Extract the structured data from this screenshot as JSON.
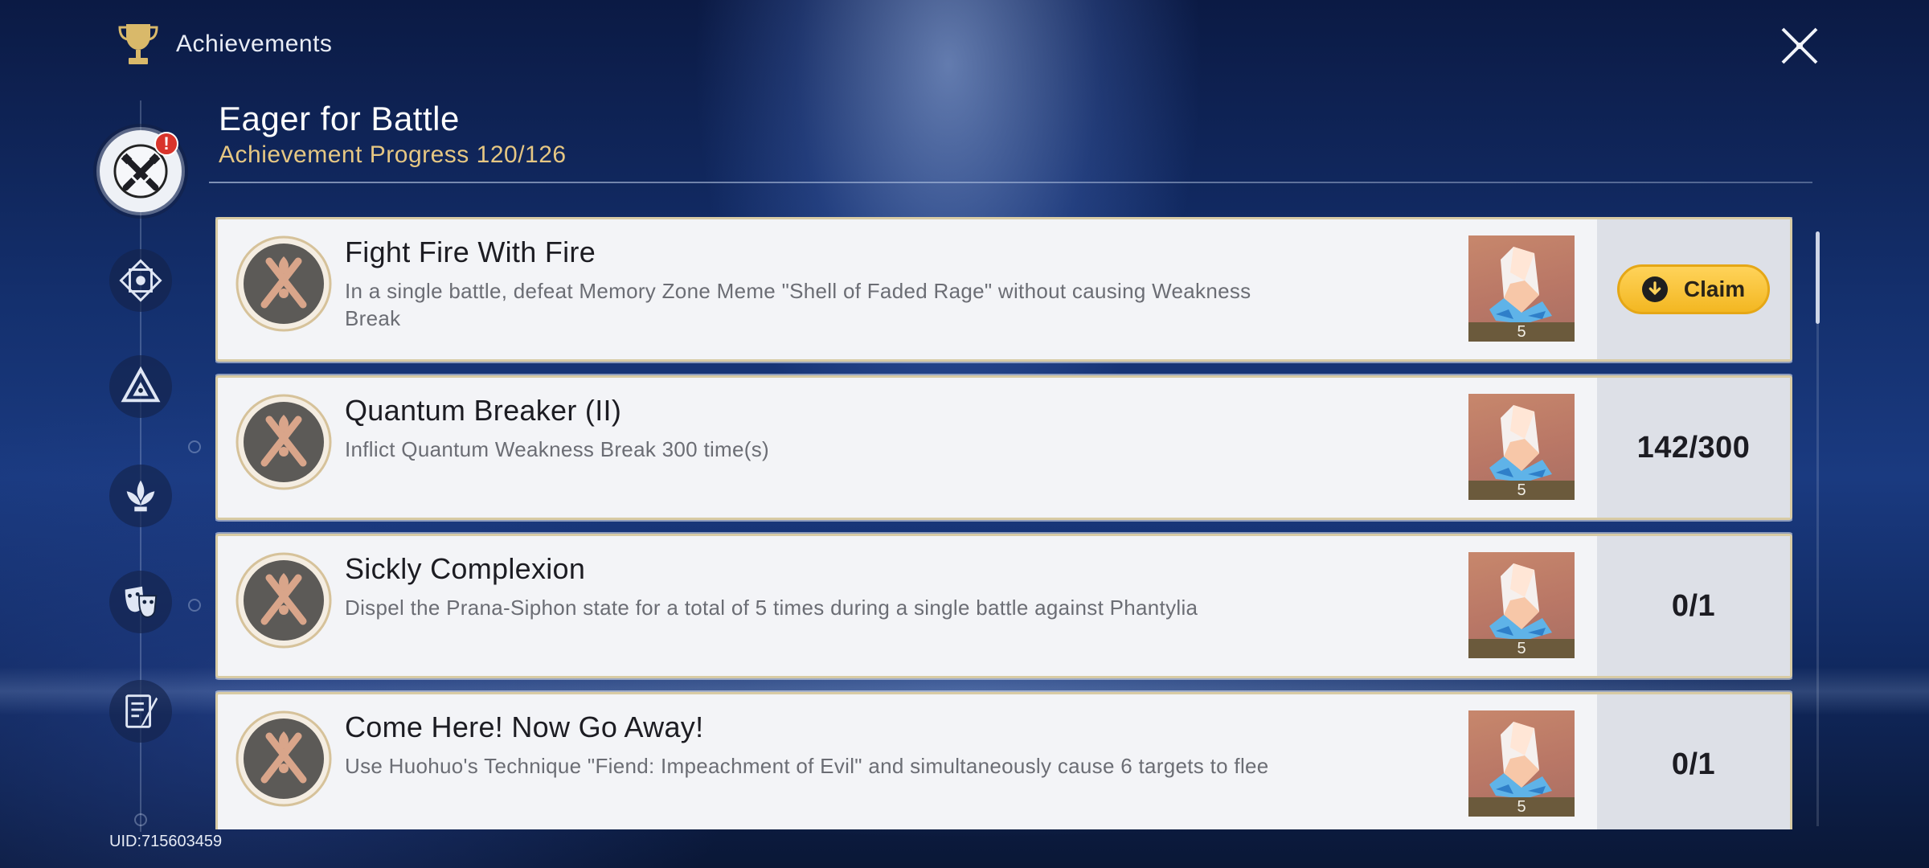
{
  "header": {
    "title": "Achievements"
  },
  "section": {
    "title": "Eager for Battle",
    "progress": "Achievement Progress 120/126"
  },
  "sidebar": {
    "categories": [
      {
        "icon": "crossed-swords-icon",
        "active": true,
        "badge": "!"
      },
      {
        "icon": "diamond-emblem-icon",
        "active": false
      },
      {
        "icon": "triangle-emblem-icon",
        "active": false
      },
      {
        "icon": "lotus-emblem-icon",
        "active": false
      },
      {
        "icon": "theater-masks-icon",
        "active": false
      },
      {
        "icon": "book-quill-icon",
        "active": false
      }
    ]
  },
  "achievements": [
    {
      "title": "Fight Fire With Fire",
      "description": "In a single battle, defeat Memory Zone Meme \"Shell of Faded Rage\" without causing Weakness Break",
      "reward_count": "5",
      "status": "claim",
      "claim_label": "Claim"
    },
    {
      "title": "Quantum Breaker (II)",
      "description": "Inflict Quantum Weakness Break 300 time(s)",
      "reward_count": "5",
      "status": "142/300"
    },
    {
      "title": "Sickly Complexion",
      "description": "Dispel the Prana-Siphon state for a total of 5 times during a single battle against Phantylia",
      "reward_count": "5",
      "status": "0/1"
    },
    {
      "title": "Come Here! Now Go Away!",
      "description": "Use Huohuo's Technique \"Fiend: Impeachment of Evil\" and simultaneously cause 6 targets to flee",
      "reward_count": "5",
      "status": "0/1"
    }
  ],
  "footer": {
    "uid": "UID:715603459"
  },
  "colors": {
    "accent_gold": "#e6c783",
    "claim_yellow": "#ffd35a",
    "card_bg": "#f3f4f7",
    "badge_red": "#d9342b"
  }
}
